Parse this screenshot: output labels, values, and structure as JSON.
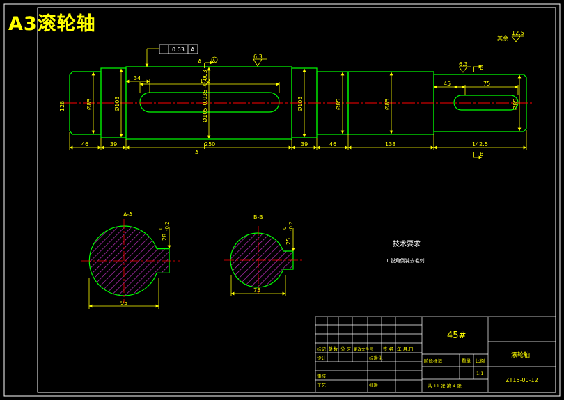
{
  "title_banner": "A3滚轮轴",
  "shaft_dims": {
    "d_left_end": "128",
    "d_journal_1": "Ø85",
    "d_shoulder_1": "Ø103",
    "d_main": "Ø105-0.035 -0.003",
    "key1_len": "172",
    "key1_offset": "34",
    "d_shoulder_2": "Ø103",
    "d_journal_2": "Ø85",
    "d_mid": "Ø85",
    "d_right_end": "Ø85",
    "key2_offset": "45",
    "key2_len": "75",
    "len_1": "46",
    "len_2": "39",
    "len_3": "250",
    "len_4": "39",
    "len_5": "46",
    "len_6": "138",
    "len_7": "142.5"
  },
  "tolerance_frame": {
    "value": "0.03",
    "datum": "A"
  },
  "roughness": {
    "mark_1": "6.3",
    "mark_2": "6.3",
    "other": "其余",
    "other_value": "12.5"
  },
  "section_marks": {
    "a_left": "A",
    "a_circle": "A",
    "a_bottom": "A",
    "b_top": "B",
    "b_bottom": "B"
  },
  "section_a": {
    "title": "A-A",
    "dia": "95",
    "key_depth": "28",
    "tol_upper": "0",
    "tol_lower": "-0.2"
  },
  "section_b": {
    "title": "B-B",
    "dia": "75",
    "key_depth": "25",
    "tol_upper": "0",
    "tol_lower": "-0.2"
  },
  "tech_req": {
    "title": "技术要求",
    "item1": "1.锐角倒钝去毛刺"
  },
  "title_block": {
    "material": "45#",
    "part_name": "滚轮轴",
    "drawing_no": "ZT15-00-12",
    "row_labels": [
      "标记",
      "处数",
      "分 区",
      "更改文件号",
      "签 名",
      "年.月.日"
    ],
    "design": "设计",
    "standard": "标准化",
    "review": "审核",
    "process": "工艺",
    "approve": "批准",
    "stage_labels": [
      "阶段标记",
      "重量",
      "比例"
    ],
    "scale": "1:1",
    "sheets": "共 11 张   第 4 张"
  },
  "colors": {
    "outline": "#00ff00",
    "dimension": "#ffff00",
    "centerline": "#ff0000",
    "hatch": "#cc33cc",
    "frame": "#ffffff",
    "background": "#000000"
  }
}
